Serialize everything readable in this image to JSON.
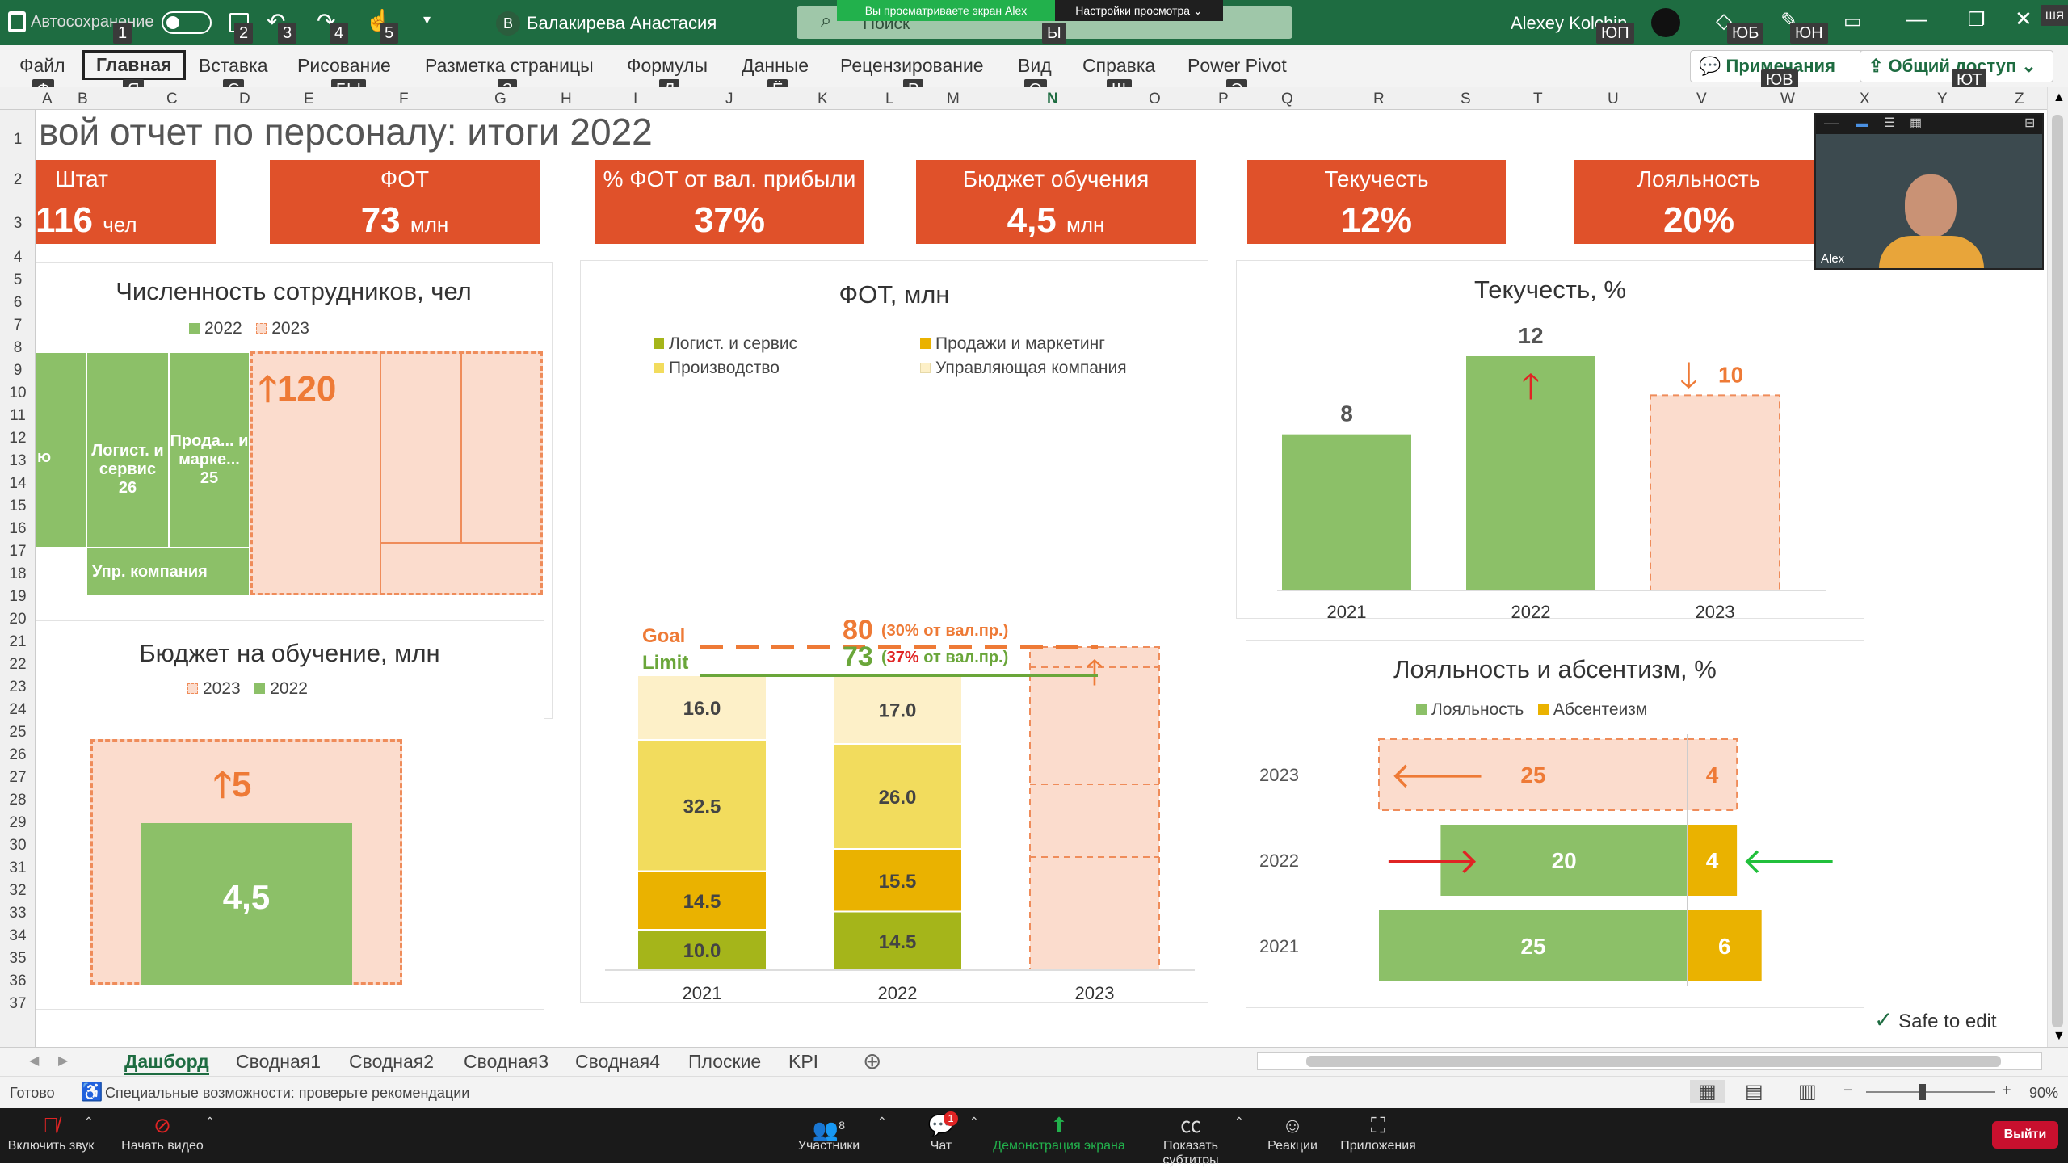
{
  "titlebar": {
    "autosave": "Автосохранение",
    "doc_owner": "Балакирева Анастасия",
    "doc_owner_initial": "B",
    "share_banner": "Вы просматриваете экран Alex",
    "view_settings": "Настройки просмотра",
    "search_placeholder": "Поиск",
    "user": "Alexey Kolchin",
    "qa_badges": [
      "1",
      "2",
      "3",
      "4",
      "5"
    ],
    "badge_y": "Ы",
    "badge_yup": "ЮП",
    "badge_yub": "ЮБ",
    "badge_yun": "ЮН",
    "badge_shsh": "ШЯ"
  },
  "ribbon": {
    "tabs": [
      "Файл",
      "Главная",
      "Вставка",
      "Рисование",
      "Разметка страницы",
      "Формулы",
      "Данные",
      "Рецензирование",
      "Вид",
      "Справка",
      "Power Pivot"
    ],
    "tab_badges": [
      "Ф",
      "Я",
      "С",
      "БЫ",
      "З",
      "Л",
      "Ё",
      "Р",
      "О",
      "Щ",
      "Э"
    ],
    "comments": "Примечания",
    "share": "Общий доступ",
    "badge_comments": "ЮВ",
    "badge_share": "ЮТ"
  },
  "columns": [
    "A",
    "B",
    "C",
    "D",
    "E",
    "F",
    "G",
    "H",
    "I",
    "J",
    "K",
    "L",
    "M",
    "N",
    "O",
    "P",
    "Q",
    "R",
    "S",
    "T",
    "U",
    "V",
    "W",
    "X",
    "Y",
    "Z"
  ],
  "rows": [
    "1",
    "2",
    "3",
    "4",
    "5",
    "6",
    "7",
    "8",
    "9",
    "10",
    "11",
    "12",
    "13",
    "14",
    "15",
    "16",
    "17",
    "18",
    "19",
    "20",
    "21",
    "22",
    "23",
    "24",
    "25",
    "26",
    "27",
    "28",
    "29",
    "30",
    "31",
    "32",
    "33",
    "34",
    "35",
    "36",
    "37"
  ],
  "dashboard": {
    "title": "вой отчет по персоналу: итоги 2022",
    "kpis": [
      {
        "label": "Штат",
        "value": "116",
        "unit": "чел"
      },
      {
        "label": "ФОТ",
        "value": "73",
        "unit": "млн"
      },
      {
        "label": "% ФОТ от вал. прибыли",
        "value": "37%",
        "unit": ""
      },
      {
        "label": "Бюджет обучения",
        "value": "4,5",
        "unit": "млн"
      },
      {
        "label": "Текучесть",
        "value": "12%",
        "unit": ""
      },
      {
        "label": "Лояльность",
        "value": "20%",
        "unit": ""
      }
    ],
    "headcount": {
      "title": "Численность сотрудников, чел",
      "legend": [
        "2022",
        "2023"
      ],
      "cells": [
        {
          "label": "Логист. и сервис",
          "value": "26"
        },
        {
          "label": "Прода... и марке...",
          "value": "25"
        },
        {
          "label": "Упр. компания",
          "value": ""
        },
        {
          "label": "ю",
          "value": ""
        }
      ],
      "target": "120"
    },
    "training": {
      "title": "Бюджет на обучение, млн",
      "legend": [
        "2023",
        "2022"
      ],
      "value_2022": "4,5",
      "target_2023": "5"
    },
    "turnover": {
      "title": "Текучесть, %",
      "years": [
        "2021",
        "2022",
        "2023"
      ],
      "values": [
        8,
        12,
        10
      ]
    },
    "loyalty": {
      "title": "Лояльность и абсентизм, %",
      "legend": [
        "Лояльность",
        "Абсентеизм"
      ],
      "rows": [
        {
          "year": "2023",
          "loyalty": 25,
          "absent": 4
        },
        {
          "year": "2022",
          "loyalty": 20,
          "absent": 4
        },
        {
          "year": "2021",
          "loyalty": 25,
          "absent": 6
        }
      ]
    }
  },
  "chart_data": {
    "type": "bar",
    "title": "ФОТ, млн",
    "categories": [
      "2021",
      "2022",
      "2023"
    ],
    "series": [
      {
        "name": "Логист. и сервис",
        "values": [
          10.0,
          14.5,
          null
        ],
        "color": "#a5b51a"
      },
      {
        "name": "Продажи и маркетинг",
        "values": [
          14.5,
          15.5,
          null
        ],
        "color": "#eab200"
      },
      {
        "name": "Производство",
        "values": [
          32.5,
          26.0,
          null
        ],
        "color": "#f2dc5d"
      },
      {
        "name": "Управляющая компания",
        "values": [
          16.0,
          17.0,
          null
        ],
        "color": "#fdf0c8"
      }
    ],
    "ylim": [
      0,
      80
    ],
    "goal": {
      "label": "Goal",
      "value": 80,
      "note": "(30% от вал.пр.)"
    },
    "limit": {
      "label": "Limit",
      "value": 73,
      "note_pct": "37%",
      "note_rest": "от вал.пр."
    },
    "label_decimals": 1
  },
  "sheet_tabs": [
    "Дашборд",
    "Сводная1",
    "Сводная2",
    "Сводная3",
    "Сводная4",
    "Плоские",
    "KPI"
  ],
  "status": {
    "ready": "Готово",
    "accessibility": "Специальные возможности: проверьте рекомендации",
    "zoom": "90%",
    "safe_to_edit": "Safe to edit"
  },
  "video": {
    "name": "Alex"
  },
  "zoom": {
    "mute": "Включить звук",
    "video": "Начать видео",
    "participants": "Участники",
    "participants_count": "8",
    "chat": "Чат",
    "chat_badge": "1",
    "share": "Демонстрация экрана",
    "captions": "Показать субтитры",
    "reactions": "Реакции",
    "apps": "Приложения",
    "leave": "Выйти"
  },
  "colors": {
    "kpi": "#e0512a",
    "green": "#8cc068",
    "peach": "#fbdccd",
    "peach_border": "#ef8c5a",
    "orange_arrow": "#ee7a36",
    "yellow": "#eab200",
    "red": "#e02424",
    "limit_green": "#6aa63a"
  }
}
